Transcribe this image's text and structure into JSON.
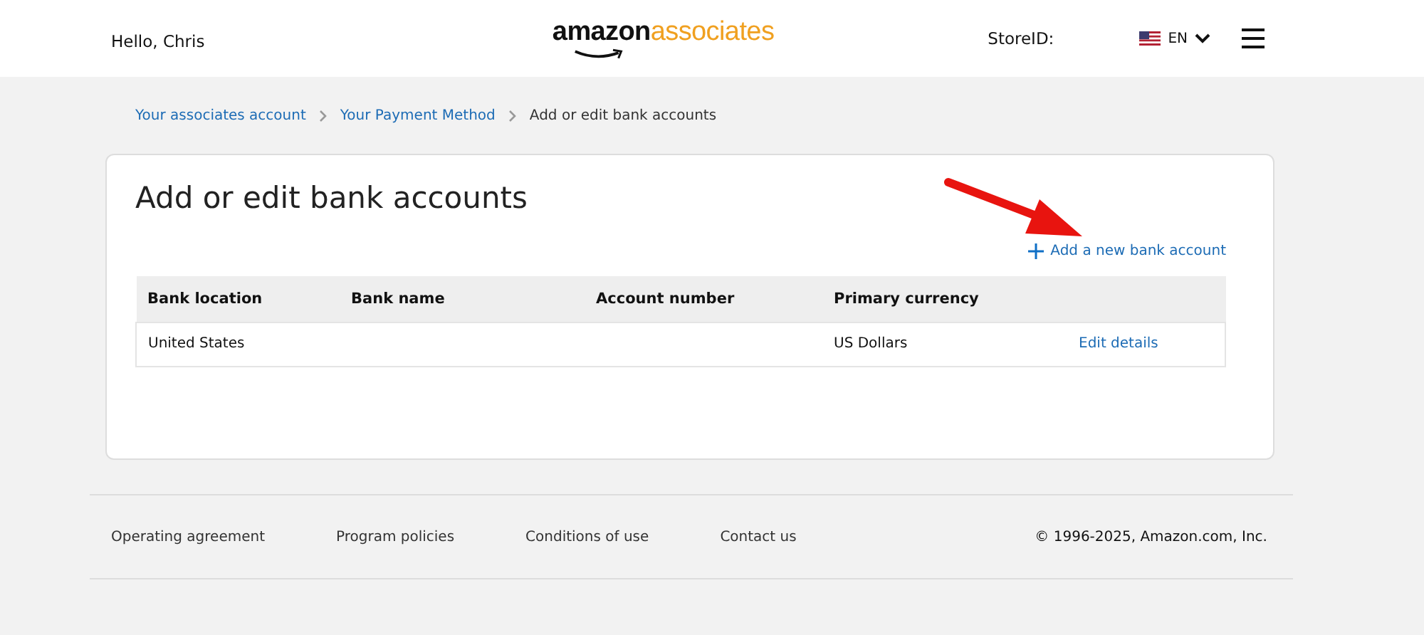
{
  "header": {
    "greeting": "Hello, Chris",
    "logo": {
      "main": "amazon",
      "accent": "associates"
    },
    "store_id_label": "StoreID:",
    "language": "EN"
  },
  "breadcrumb": [
    {
      "label": "Your associates account",
      "link": true
    },
    {
      "label": "Your Payment Method",
      "link": true
    },
    {
      "label": "Add or edit bank accounts",
      "link": false
    }
  ],
  "card": {
    "title": "Add or edit bank accounts",
    "add_link": "Add a new bank account",
    "table": {
      "columns": [
        "Bank location",
        "Bank name",
        "Account number",
        "Primary currency"
      ],
      "rows": [
        {
          "cells": [
            "United States",
            "",
            "",
            "US Dollars"
          ],
          "action": "Edit details"
        }
      ]
    }
  },
  "footer": {
    "links": [
      "Operating agreement",
      "Program policies",
      "Conditions of use",
      "Contact us"
    ],
    "copyright": "© 1996-2025, Amazon.com, Inc."
  }
}
